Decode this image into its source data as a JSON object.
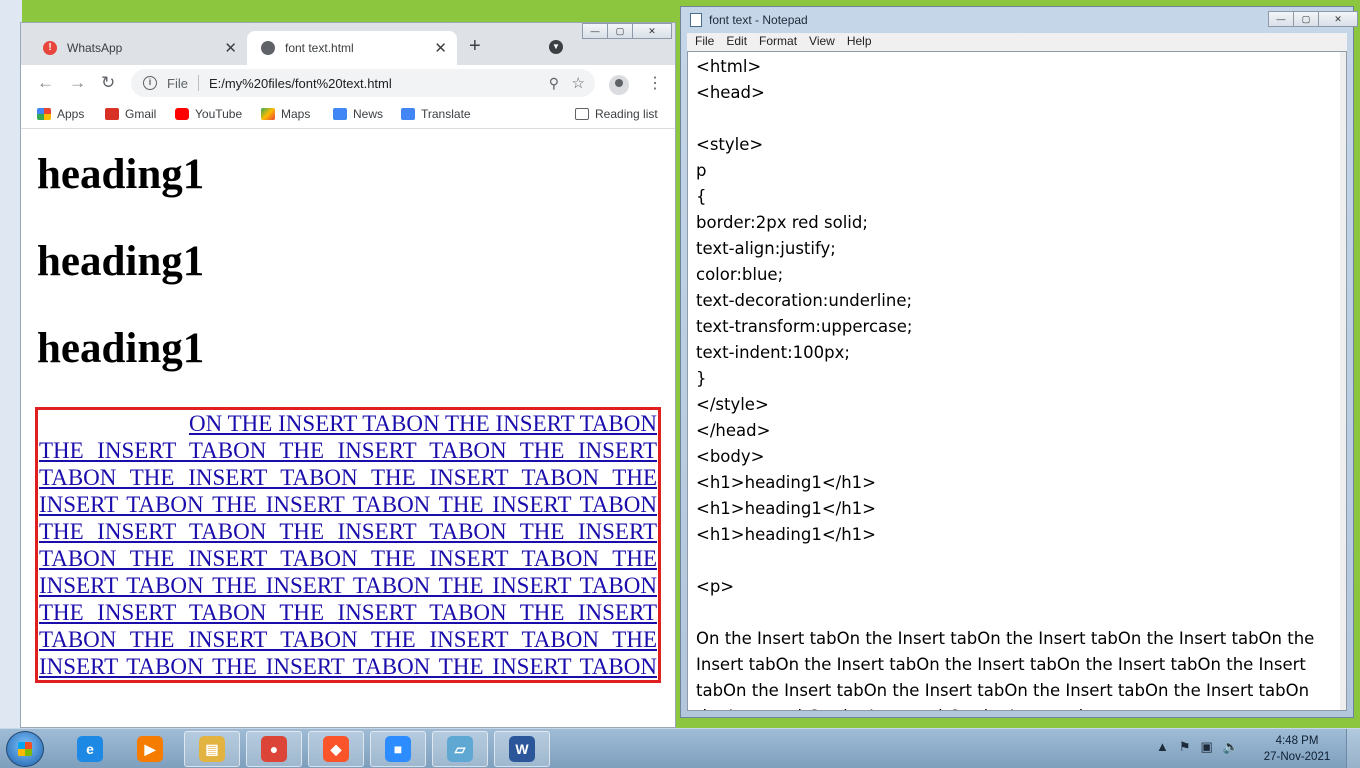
{
  "browser": {
    "tabs": [
      {
        "label": "WhatsApp",
        "close": "✕"
      },
      {
        "label": "font text.html",
        "close": "✕"
      }
    ],
    "new_tab": "+",
    "address": {
      "scheme_label": "File",
      "url": "E:/my%20files/font%20text.html"
    },
    "bookmarks": [
      {
        "label": "Apps",
        "color": "#ea4335"
      },
      {
        "label": "Gmail",
        "color": "#d93025"
      },
      {
        "label": "YouTube",
        "color": "#ff0000"
      },
      {
        "label": "Maps",
        "color": "#34a853"
      },
      {
        "label": "News",
        "color": "#4285f4"
      },
      {
        "label": "Translate",
        "color": "#4285f4"
      }
    ],
    "reading_list": "Reading list",
    "page": {
      "headings": [
        "heading1",
        "heading1",
        "heading1"
      ],
      "paragraph": "On the Insert tabOn the Insert tabOn the Insert tabOn the Insert tabOn the Insert tabOn the Insert tabOn the Insert tabOn the Insert tabOn the Insert tabOn the Insert tabOn the Insert tabOn the Insert tabOn the Insert tabOn the Insert tabOn the Insert tabOn the Insert tabOn the Insert tabOn the Insert tabOn the Insert tabOn the Insert tabOn the Insert tabOn the Insert tabOn the Insert tabOn the Insert tabOn the Insert tabOn the Insert tabOn the Insert tabOn the Insert tabOn the Insert tabOn the Insert tabOn the Insert tab",
      "border_color": "#e02020",
      "text_color": "#1a0dab"
    }
  },
  "notepad": {
    "title": "font text - Notepad",
    "menu": [
      "File",
      "Edit",
      "Format",
      "View",
      "Help"
    ],
    "content": "<html>\n<head>\n\n<style>\np\n{\nborder:2px red solid;\ntext-align:justify;\ncolor:blue;\ntext-decoration:underline;\ntext-transform:uppercase;\ntext-indent:100px;\n}\n</style>\n</head>\n<body>\n<h1>heading1</h1>\n<h1>heading1</h1>\n<h1>heading1</h1>\n\n<p>\n\nOn the Insert tabOn the Insert tabOn the Insert tabOn the Insert tabOn the Insert tabOn the Insert tabOn the Insert tabOn the Insert tabOn the Insert tabOn the Insert tabOn the Insert tabOn the Insert tabOn the Insert tabOn the Insert tabOn the Insert tabOn the Insert tab"
  },
  "taskbar": {
    "apps": [
      {
        "name": "internet-explorer",
        "glyph": "e",
        "color": "#1e88e5"
      },
      {
        "name": "media-player",
        "glyph": "▶",
        "color": "#f57c00"
      },
      {
        "name": "file-explorer",
        "glyph": "▤",
        "color": "#e3b341"
      },
      {
        "name": "chrome",
        "glyph": "●",
        "color": "#db4437"
      },
      {
        "name": "brave",
        "glyph": "◆",
        "color": "#fb542b"
      },
      {
        "name": "zoom",
        "glyph": "■",
        "color": "#2d8cff"
      },
      {
        "name": "notepad",
        "glyph": "▱",
        "color": "#5fa8d3"
      },
      {
        "name": "word",
        "glyph": "W",
        "color": "#2b579a"
      }
    ],
    "clock": {
      "time": "4:48 PM",
      "date": "27-Nov-2021"
    }
  }
}
